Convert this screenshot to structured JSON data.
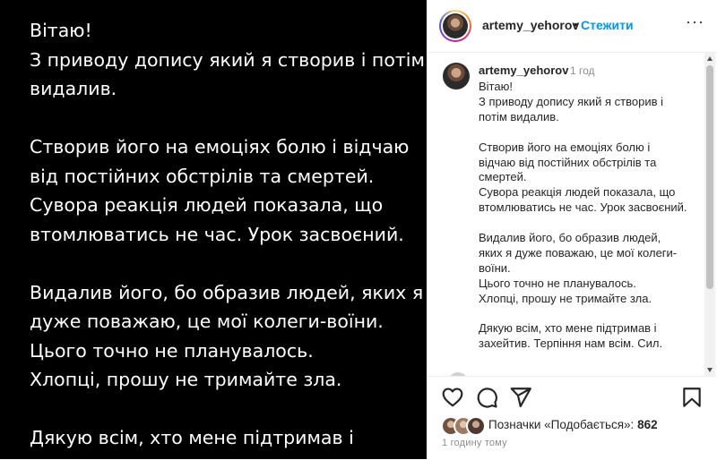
{
  "post_image": {
    "lines": [
      "Вітаю!",
      "З приводу допису який я створив і потім",
      "видалив.",
      "",
      "Створив його на емоціях болю і відчаю",
      "від постійних обстрілів та смертей.",
      "Сувора реакція людей показала, що",
      "втомлюватись не час. Урок засвоєний.",
      "",
      "Видалив його, бо образив людей, яких я",
      "дуже поважаю, це мої колеги-воїни.",
      "Цього точно не планувалось.",
      "Хлопці, прошу не тримайте зла.",
      "",
      "Дякую всім, хто мене підтримав і"
    ]
  },
  "header": {
    "username": "artemy_yehorov",
    "dot": "•",
    "follow_label": "Стежити",
    "more": "···"
  },
  "caption": {
    "username": "artemy_yehorov",
    "time": "1 год",
    "lines": [
      "Вітаю!",
      "З приводу допису який я створив і",
      "потім видалив.",
      "",
      "Створив його на емоціях болю і",
      "відчаю від постійних обстрілів та",
      "смертей.",
      "Сувора реакція людей показала, що",
      "втомлюватись не час. Урок засвоєний.",
      "",
      "Видалив його, бо образив людей,",
      "яких я дуже поважаю, це мої колеги-",
      "воїни.",
      "Цього точно не планувалось.",
      "Хлопці, прошу не тримайте зла.",
      "",
      "Дякую всім, хто мене підтримав і",
      "захейтив. Терпіння нам всім. Сил."
    ]
  },
  "actions": {
    "icons": [
      "heart-icon",
      "comment-icon",
      "share-icon",
      "bookmark-icon"
    ],
    "likes_prefix": "Позначки «Подобається»:",
    "likes_count": "862",
    "date": "1 годину тому"
  },
  "colors": {
    "link": "#0095f6",
    "text": "#262626",
    "muted": "#8e8e8e"
  }
}
